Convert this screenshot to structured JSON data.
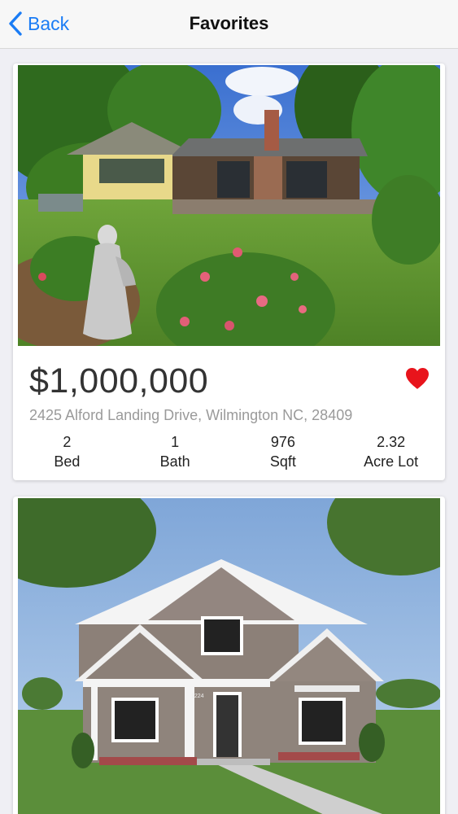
{
  "nav": {
    "back_label": "Back",
    "title": "Favorites"
  },
  "listings": [
    {
      "price": "$1,000,000",
      "address": "2425 Alford Landing Drive, Wilmington NC, 28409",
      "favorite": true,
      "favorite_icon": "heart-filled-icon",
      "favorite_color": "#e8141c",
      "stats": [
        {
          "value": "2",
          "label": "Bed"
        },
        {
          "value": "1",
          "label": "Bath"
        },
        {
          "value": "976",
          "label": "Sqft"
        },
        {
          "value": "2.32",
          "label": "Acre Lot"
        }
      ]
    },
    {
      "photo_text": "1224"
    }
  ],
  "colors": {
    "accent": "#1a7cf5",
    "price_text": "#333333",
    "address_text": "#9a9a9a"
  }
}
